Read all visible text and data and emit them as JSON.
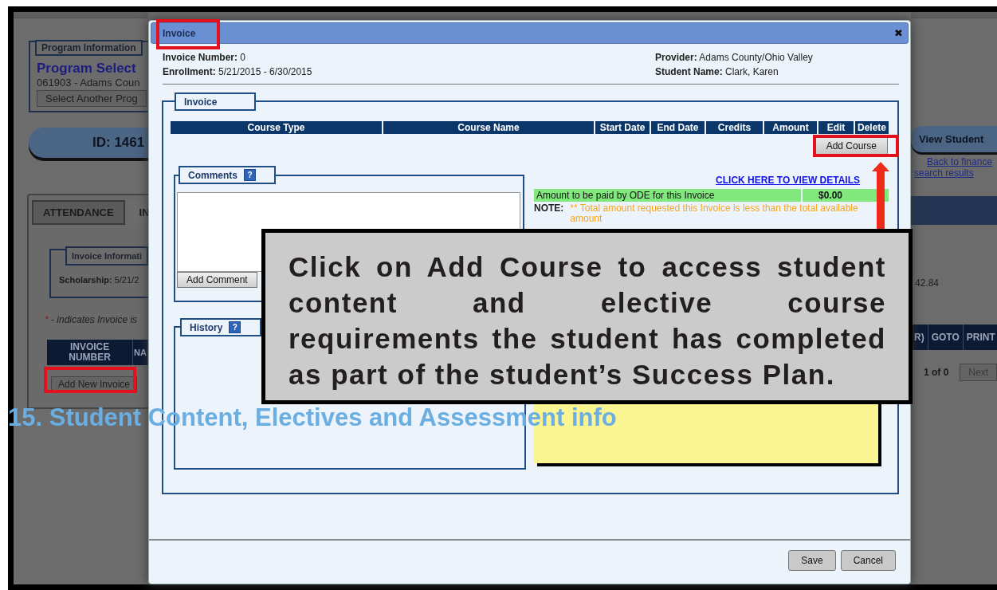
{
  "background_page": {
    "program_information": {
      "legend": "Program Information",
      "title": "Program Select",
      "code": "061903 - Adams Coun",
      "button": "Select Another Prog"
    },
    "id_banner": "ID: 1461",
    "tabs": [
      {
        "label": "ATTENDANCE",
        "selected": false
      },
      {
        "label": "IN",
        "selected": true
      }
    ],
    "invoice_information": {
      "legend": "Invoice Informati",
      "scholarship": "**Scholarship:** 5/21/2"
    },
    "legend_note": {
      "mark": "*",
      "text": " - indicates Invoice is"
    },
    "table_columns": [
      "INVOICE NUMBER",
      "NA"
    ],
    "add_new_invoice_button": "Add New Invoice",
    "right_side": {
      "view_student_button": "View Student",
      "back_links": [
        "Back to finance",
        "search results"
      ],
      "amount": "42.84",
      "table_columns": [
        "R)",
        "GOTO",
        "PRINT"
      ],
      "pager": "1 of 0",
      "next_button": "Next"
    }
  },
  "dialog": {
    "title": "Invoice",
    "close_glyph": "✖",
    "info_left": [
      "**Invoice Number:** 0",
      "**Enrollment:** 5/21/2015 - 6/30/2015"
    ],
    "info_right": [
      "**Provider:** Adams County/Ohio Valley",
      "**Student Name:** Clark, Karen"
    ],
    "invoice_section": {
      "legend": "Invoice",
      "columns": [
        "Course Type",
        "Course Name",
        "Start Date",
        "End Date",
        "Credits",
        "Amount",
        "Edit",
        "Delete"
      ],
      "add_course_button": "Add Course"
    },
    "comments": {
      "legend": "Comments",
      "help_glyph": "?",
      "add_comment_button": "Add Comment"
    },
    "details_link": "CLICK HERE TO VIEW DETAILS",
    "amount_row": {
      "label": "Amount to be paid by ODE for this Invoice",
      "value": "$0.00"
    },
    "note": {
      "label": "NOTE:",
      "text": "** Total amount requested this Invoice is less than the total available amount"
    },
    "history": {
      "legend": "History",
      "help_glyph": "?"
    },
    "buttons": [
      "Save",
      "Cancel"
    ]
  },
  "callout": {
    "text": "Click on Add Course to access student content and elective course requirements the student has completed as part of the student’s Success Plan."
  },
  "heading": "15. Student Content, Electives and Assessment info"
}
